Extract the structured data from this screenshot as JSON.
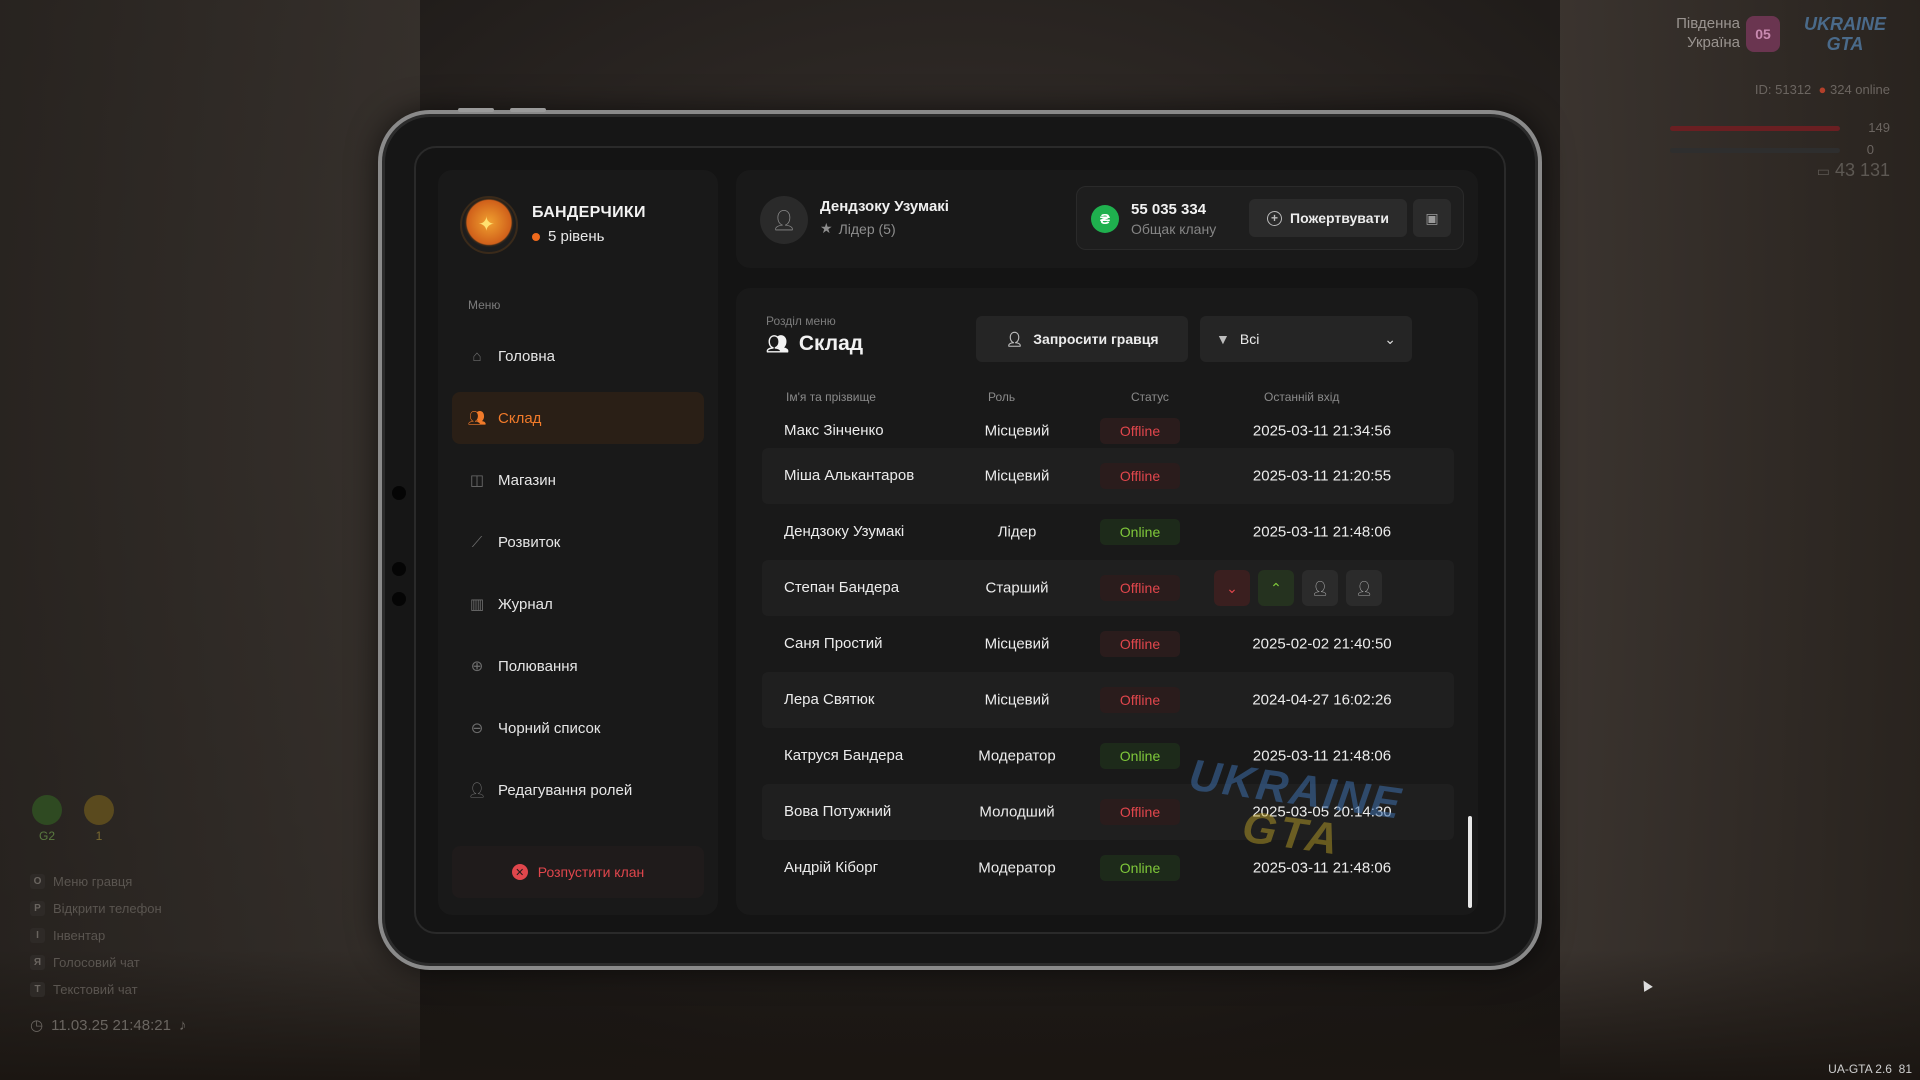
{
  "hud": {
    "server_line1": "Південна",
    "server_line2": "Україна",
    "server_badge": "05",
    "brand_line1": "UKRAINE",
    "brand_line2": "GTA",
    "player_id": "ID: 51312",
    "online": "324 online",
    "health": "149",
    "armor": "0",
    "money": "43 131",
    "stat1": "G2",
    "stat2": "1",
    "keys": [
      {
        "key": "O",
        "label": "Меню гравця"
      },
      {
        "key": "P",
        "label": "Відкрити телефон"
      },
      {
        "key": "I",
        "label": "Інвентар"
      },
      {
        "key": "Я",
        "label": "Голосовий чат"
      },
      {
        "key": "T",
        "label": "Текстовий чат"
      }
    ],
    "datetime": "11.03.25 21:48:21",
    "version": "UA-GTA 2.6",
    "version_suffix": "81"
  },
  "clan": {
    "name": "БАНДЕРЧИКИ",
    "level": "5 рівень"
  },
  "menu": {
    "caption": "Меню",
    "items": [
      {
        "label": "Головна",
        "icon": "home-icon"
      },
      {
        "label": "Склад",
        "icon": "members-icon"
      },
      {
        "label": "Магазин",
        "icon": "basket-icon"
      },
      {
        "label": "Розвиток",
        "icon": "chart-icon"
      },
      {
        "label": "Журнал",
        "icon": "book-icon"
      },
      {
        "label": "Полювання",
        "icon": "crosshair-icon"
      },
      {
        "label": "Чорний список",
        "icon": "block-icon"
      },
      {
        "label": "Редагування ролей",
        "icon": "user-edit-icon"
      }
    ],
    "active_index": 1,
    "disband_label": "Розпустити клан"
  },
  "header": {
    "player_name": "Дендзоку Узумакі",
    "player_role": "Лідер (5)",
    "balance": "55 035 334",
    "balance_label": "Общак клану",
    "donate_label": "Пожертвувати"
  },
  "section": {
    "caption": "Розділ меню",
    "title": "Склад",
    "invite_label": "Запросити гравця",
    "filter_value": "Всі"
  },
  "table": {
    "columns": [
      "Ім'я та прізвище",
      "Роль",
      "Статус",
      "Останній вхід"
    ],
    "rows": [
      {
        "name": "Макс Зінченко",
        "role": "Місцевий",
        "status": "Offline",
        "last": "2025-03-11 21:34:56"
      },
      {
        "name": "Міша Алькантаров",
        "role": "Місцевий",
        "status": "Offline",
        "last": "2025-03-11 21:20:55"
      },
      {
        "name": "Дендзоку Узумакі",
        "role": "Лідер",
        "status": "Online",
        "last": "2025-03-11 21:48:06"
      },
      {
        "name": "Степан Бандера",
        "role": "Старший",
        "status": "Offline",
        "last": ""
      },
      {
        "name": "Саня Простий",
        "role": "Місцевий",
        "status": "Offline",
        "last": "2025-02-02 21:40:50"
      },
      {
        "name": "Лера Святюк",
        "role": "Місцевий",
        "status": "Offline",
        "last": "2024-04-27 16:02:26"
      },
      {
        "name": "Катруся Бандера",
        "role": "Модератор",
        "status": "Online",
        "last": "2025-03-11 21:48:06"
      },
      {
        "name": "Вова Потужний",
        "role": "Молодший",
        "status": "Offline",
        "last": "2025-03-05 20:14:30"
      },
      {
        "name": "Андрій Кіборг",
        "role": "Модератор",
        "status": "Online",
        "last": "2025-03-11 21:48:06"
      }
    ]
  },
  "watermark": {
    "line1": "UKRAINE",
    "line2": "GTA"
  },
  "colors": {
    "accent": "#f07a2a",
    "online": "#7fc83a",
    "offline": "#e0464c",
    "money": "#1fb04e"
  }
}
